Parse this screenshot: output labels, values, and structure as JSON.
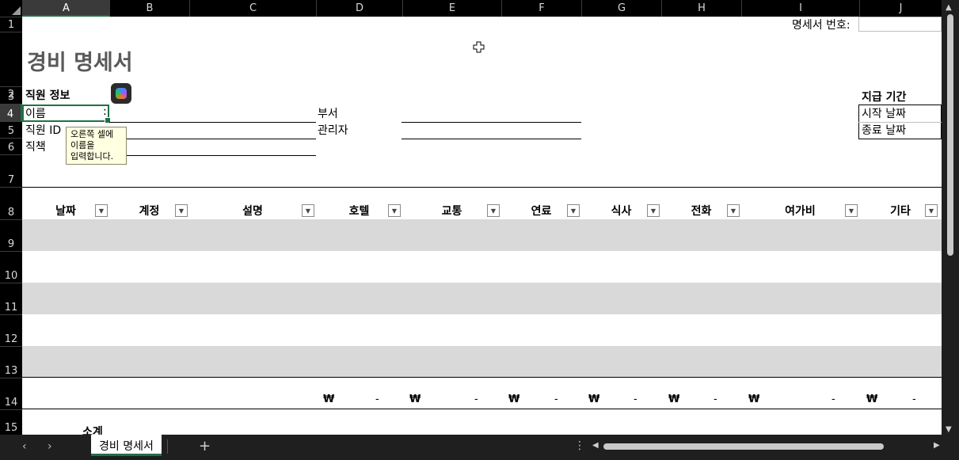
{
  "columns": [
    "A",
    "B",
    "C",
    "D",
    "E",
    "F",
    "G",
    "H",
    "I",
    "J"
  ],
  "selected_column": "A",
  "rows": [
    "1",
    "2",
    "3",
    "4",
    "5",
    "6",
    "7",
    "8",
    "9",
    "10",
    "11",
    "12",
    "13",
    "14",
    "15"
  ],
  "selected_row": "4",
  "sheet": {
    "invoice_label": "명세서 번호:",
    "title": "경비 명세서",
    "employee_section": "직원 정보",
    "period_section": "지급 기간",
    "name_label": "이름",
    "name_colon": ":",
    "employee_id_label": "직원 ID",
    "position_label": "직책",
    "department_label": "부서",
    "manager_label": "관리자",
    "start_date_label": "시작 날짜",
    "end_date_label": "종료 날짜",
    "headers": [
      "날짜",
      "계정",
      "설명",
      "호텔",
      "교통",
      "연료",
      "식사",
      "전화",
      "여가비",
      "기타"
    ],
    "totals": [
      {
        "currency": "₩",
        "value": "-"
      },
      {
        "currency": "₩",
        "value": "-"
      },
      {
        "currency": "₩",
        "value": "-"
      },
      {
        "currency": "₩",
        "value": "-"
      },
      {
        "currency": "₩",
        "value": "-"
      },
      {
        "currency": "₩",
        "value": "-"
      },
      {
        "currency": "₩",
        "value": "-"
      }
    ],
    "subtotal_label": "소계"
  },
  "tooltip": "오른쪽 셀에\n이름을\n입력합니다.",
  "icons": {
    "dropdown": "chevron-down-icon",
    "copilot": "copilot-icon",
    "cursor": "plus-cursor-icon"
  },
  "tabs": {
    "active_sheet": "경비 명세서",
    "add_sheet": "+",
    "prev": "‹",
    "next": "›",
    "more": "⋮"
  },
  "colors": {
    "accent": "#1e7145",
    "band": "#d9d9d9",
    "title": "#595959"
  }
}
